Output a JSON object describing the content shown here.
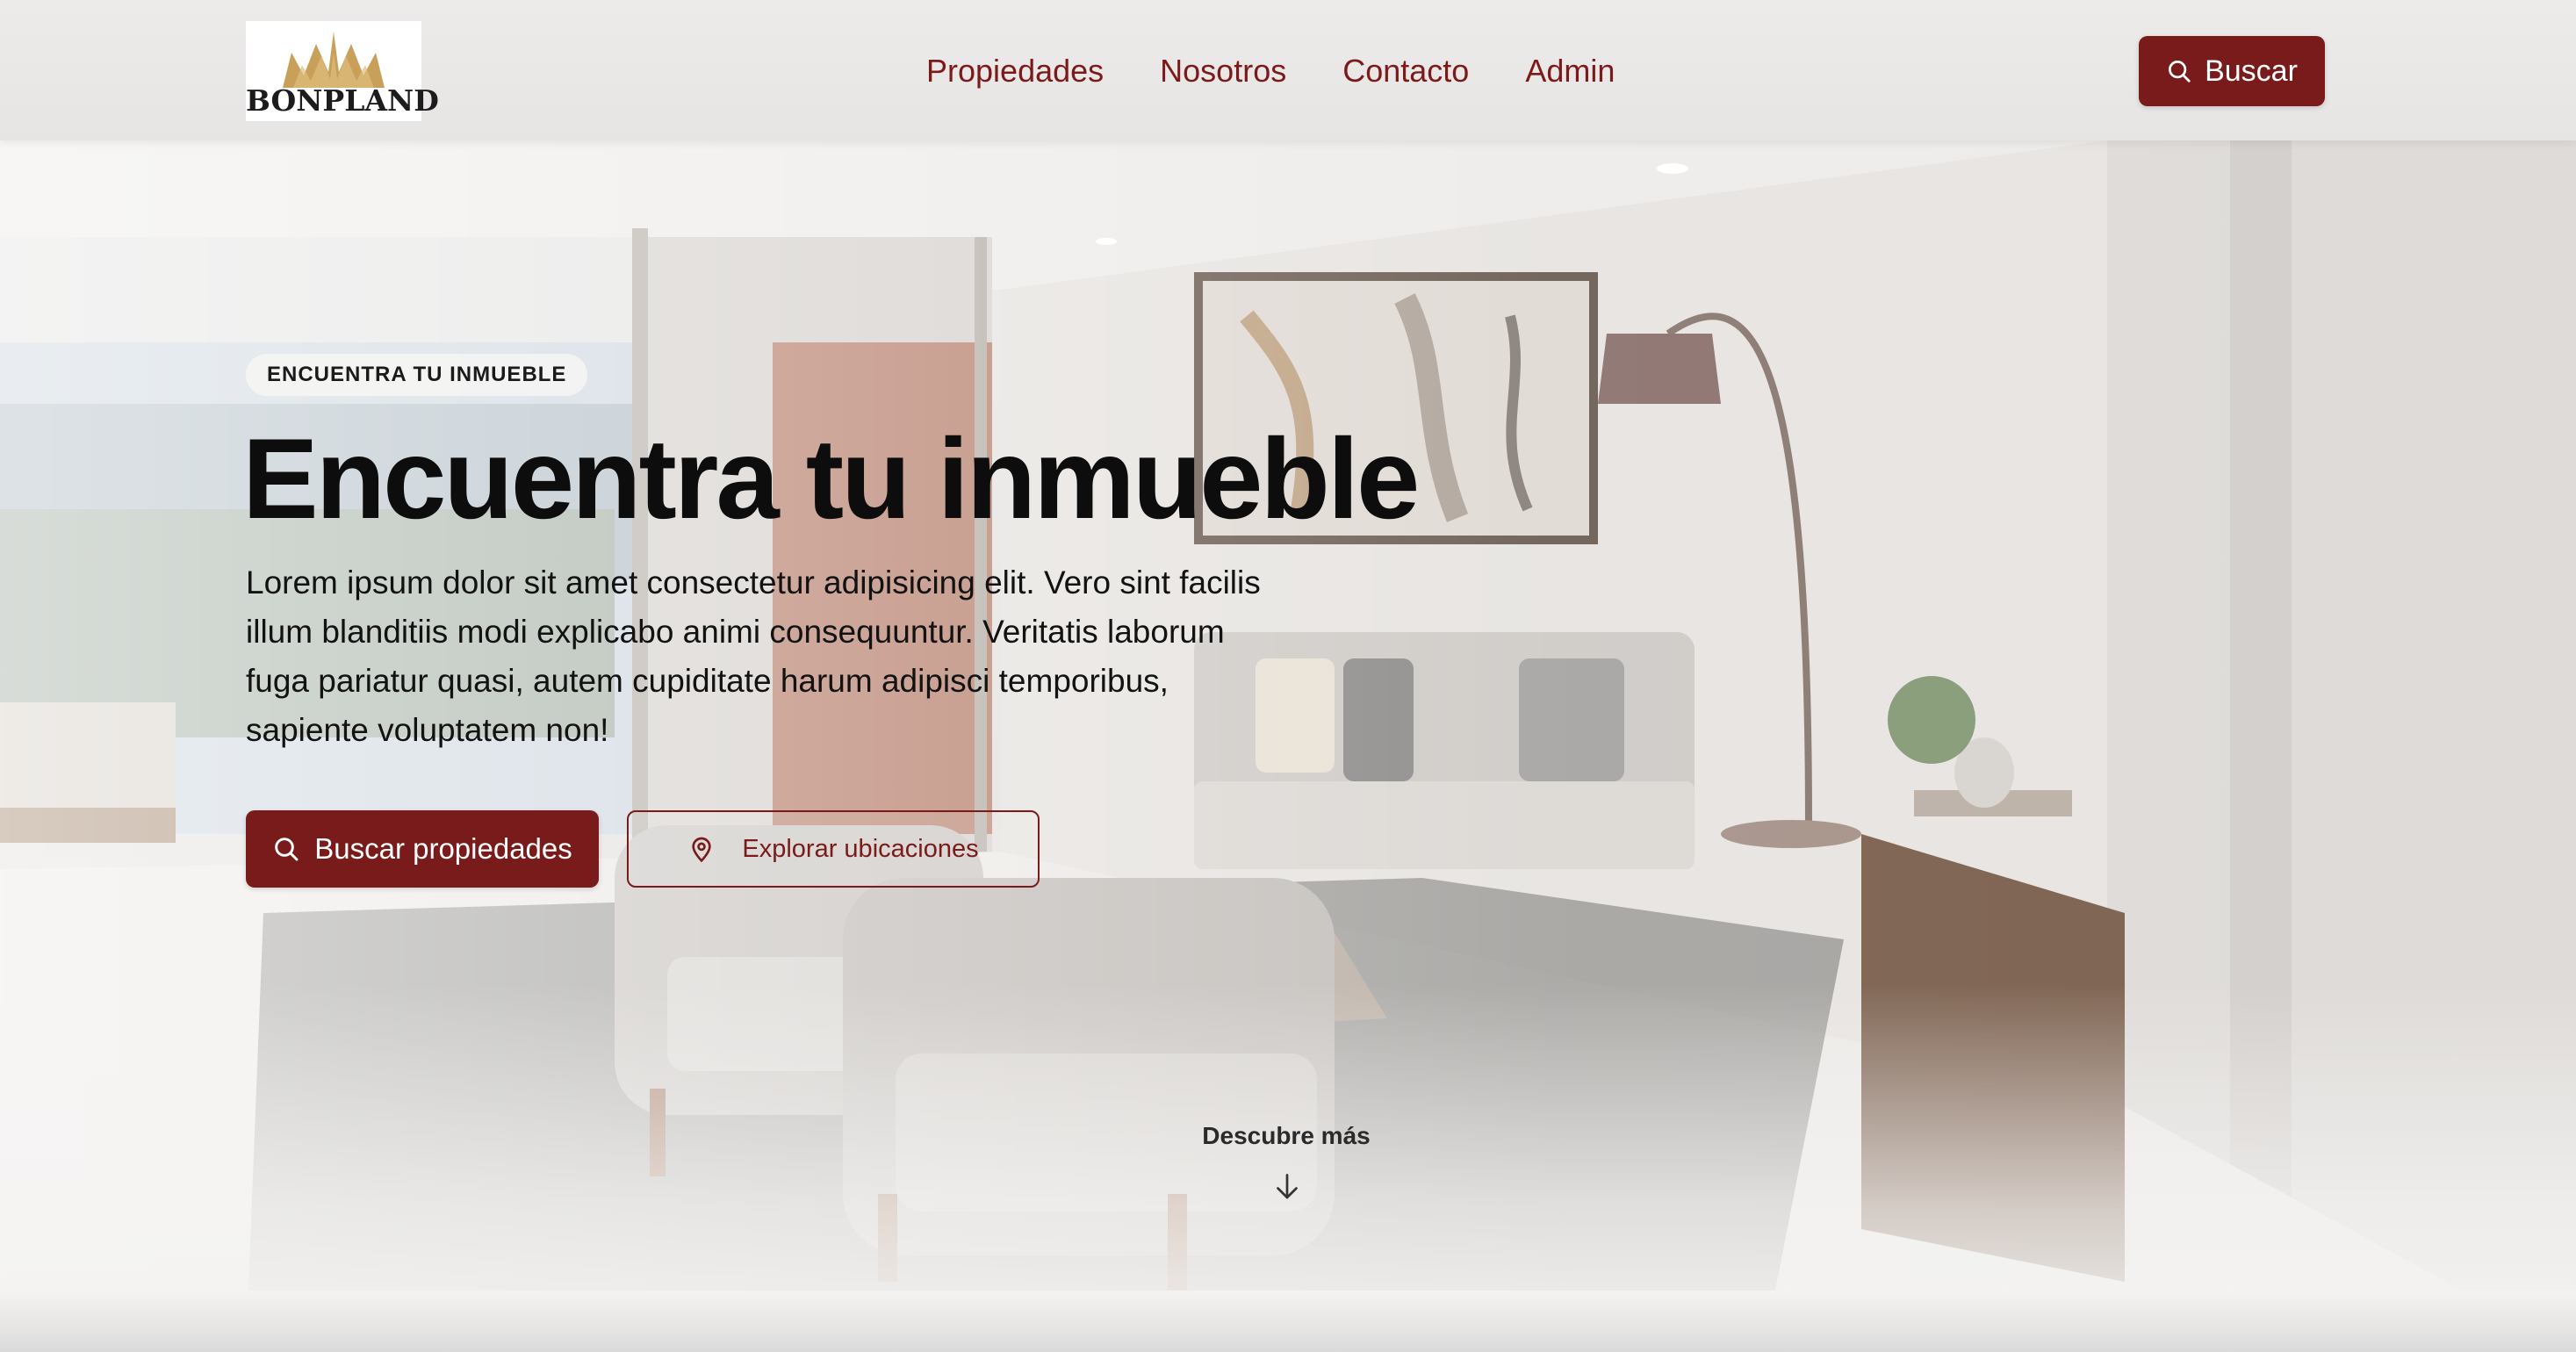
{
  "brand": {
    "name": "BONPLAND",
    "gold": "#c9a05a",
    "accent": "#7a1b1b"
  },
  "nav": {
    "items": [
      "Propiedades",
      "Nosotros",
      "Contacto",
      "Admin"
    ]
  },
  "header": {
    "search_button": {
      "label": "Buscar",
      "icon": "search-icon"
    }
  },
  "hero": {
    "badge": "ENCUENTRA TU INMUEBLE",
    "title": "Encuentra tu inmueble",
    "lead": "Lorem ipsum dolor sit amet consectetur adipisicing elit. Vero sint facilis illum blanditiis modi explicabo animi consequuntur. Veritatis laborum fuga pariatur quasi, autem cupiditate harum adipisci temporibus, sapiente voluptatem non!",
    "primary_button": {
      "label": "Buscar propiedades",
      "icon": "search-icon"
    },
    "secondary_button": {
      "label": "Explorar ubicaciones",
      "icon": "map-pin-icon"
    },
    "scroll_hint": {
      "label": "Descubre más",
      "icon": "arrow-down-icon"
    }
  }
}
